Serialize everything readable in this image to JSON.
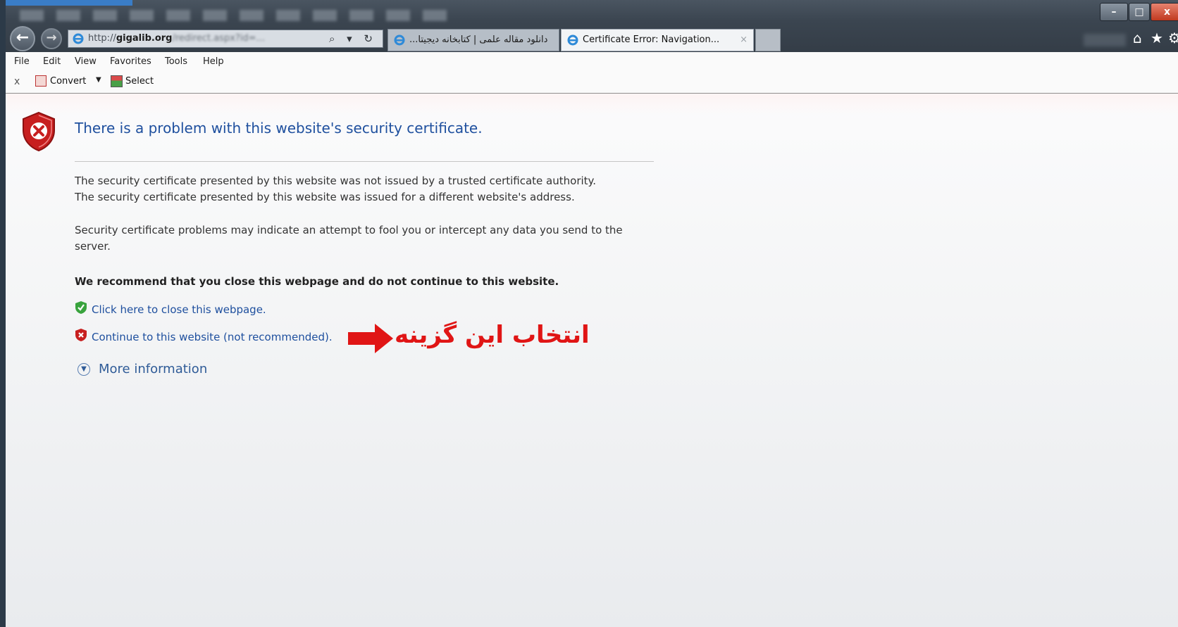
{
  "titlebar": {
    "close_glyph": "x"
  },
  "address_bar": {
    "url_prefix": "http://",
    "url_host": "gigalib.org",
    "url_rest": "/redirect.aspx?id=...",
    "search_glyph": "⌕ ▾ ↻"
  },
  "tabs": [
    {
      "label": "...دانلود مقاله علمی | کتابخانه دیجیتا"
    },
    {
      "label": "Certificate Error: Navigation...",
      "close": "×"
    }
  ],
  "menu": [
    "File",
    "Edit",
    "View",
    "Favorites",
    "Tools",
    "Help"
  ],
  "command_bar": {
    "close": "x",
    "convert_label": "Convert",
    "dropdown": "▼",
    "select_label": "Select"
  },
  "content": {
    "headline": "There is a problem with this website's security certificate.",
    "line1": "The security certificate presented by this website was not issued by a trusted certificate authority.",
    "line2": "The security certificate presented by this website was issued for a different website's address.",
    "line3": "Security certificate problems may indicate an attempt to fool you or intercept any data you send to the server.",
    "recommend": "We recommend that you close this webpage and do not continue to this website.",
    "close_link": "Click here to close this webpage.",
    "continue_link": "Continue to this website (not recommended).",
    "more_info": "More information"
  },
  "annotation": {
    "text": "انتخاب این گزینه",
    "color": "#e01515"
  },
  "colors": {
    "link": "#1e4f9e",
    "heading": "#1e4f9e"
  }
}
